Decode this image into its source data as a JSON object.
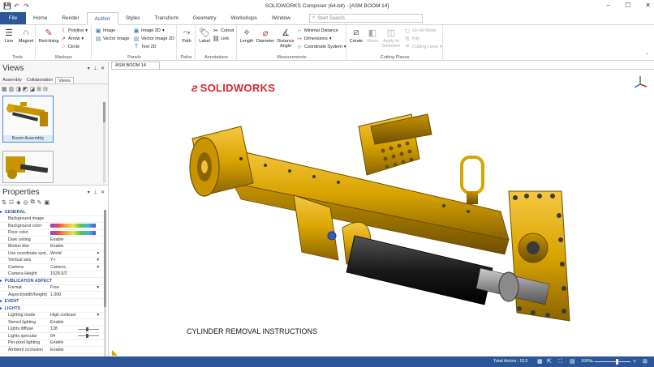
{
  "app": {
    "title": "SOLIDWORKS Composer (64-bit) - [ASM BOOM 14]",
    "window_controls": [
      "–",
      "☐",
      "✕"
    ],
    "quick_access": [
      "save",
      "undo",
      "redo"
    ]
  },
  "tabs": {
    "file": "File",
    "items": [
      "Home",
      "Render",
      "Author",
      "Styles",
      "Transform",
      "Geometry",
      "Workshops",
      "Window"
    ],
    "active": "Author",
    "search_placeholder": "Start Search"
  },
  "ribbon": {
    "groups": {
      "tools": "Tools",
      "markups": "Markups",
      "panels": "Panels",
      "paths": "Paths",
      "annotations": "Annotations",
      "measurements": "Measurements",
      "cutting_planes": "Cutting Planes"
    },
    "tools": {
      "line": "Line",
      "magnet": "Magnet"
    },
    "markups": {
      "redlining": "Red-lining",
      "polyline": "Polyline",
      "arrow": "Arrow",
      "circle": "Circle"
    },
    "panels": {
      "image": "Image",
      "vector_image": "Vector Image",
      "image_2d": "Image 2D",
      "vector_image_2d": "Vector Image 2D",
      "text_2d": "Text 2D"
    },
    "paths": {
      "path": "Path"
    },
    "annotations": {
      "label": "Label",
      "cutout": "Cutout",
      "link": "Link"
    },
    "measurements": {
      "length": "Length",
      "diameter": "Diameter",
      "distance_angle": "Distance Angle",
      "minimal_distance": "Minimal Distance",
      "dimensions": "Dimensions",
      "coordinate_system": "Coordinate System"
    },
    "cutting": {
      "create": "Create",
      "show": "Show",
      "apply_to_selection": "Apply to Selection",
      "on_all_mode": "On All Mode",
      "flip": "Flip",
      "cutting_lines": "Cutting Lines"
    }
  },
  "views_panel": {
    "title": "Views",
    "tabs": [
      "Assembly",
      "Collaboration",
      "Views"
    ],
    "active_tab": "Views",
    "thumbnails": [
      {
        "caption": "Boom Assembly",
        "selected": true
      },
      {
        "caption": "",
        "selected": false
      }
    ]
  },
  "properties_panel": {
    "title": "Properties",
    "rows": [
      {
        "type": "section",
        "label": "GENERAL"
      },
      {
        "label": "Background image",
        "value": ""
      },
      {
        "label": "Background color",
        "value": "",
        "swatch": true
      },
      {
        "label": "Floor color",
        "value": "",
        "swatch": true
      },
      {
        "label": "Dark ceiling",
        "value": "Enable"
      },
      {
        "label": "Motion blur",
        "value": "Enable"
      },
      {
        "label": "Use coordinate syst...",
        "value": "World",
        "dropdown": true
      },
      {
        "label": "Vertical axis",
        "value": "Y+",
        "dropdown": true
      },
      {
        "label": "Camera",
        "value": "Camera",
        "dropdown": true
      },
      {
        "label": "Camera Height",
        "value": "1528.0/2"
      },
      {
        "type": "section",
        "label": "PUBLICATION ASPECT"
      },
      {
        "label": "Format",
        "value": "Free",
        "dropdown": true
      },
      {
        "label": "Aspect(width/height)",
        "value": "1.000"
      },
      {
        "type": "section",
        "label": "EVENT"
      },
      {
        "type": "section",
        "label": "LIGHTS"
      },
      {
        "label": "Lighting mode",
        "value": "High contrast",
        "dropdown": true
      },
      {
        "label": "Stencil lighting",
        "value": "Enable"
      },
      {
        "label": "Lights diffuse",
        "value": "128",
        "slider": true
      },
      {
        "label": "Lights specular",
        "value": "64",
        "slider": true
      },
      {
        "label": "Per-pixel lighting",
        "value": "Enable"
      },
      {
        "label": "Ambient occlusion",
        "value": "Enable"
      }
    ]
  },
  "document": {
    "tab": "ASM BOOM 14",
    "logo_text": "SOLIDWORKS",
    "caption": "CYLINDER REMOVAL INSTRUCTIONS"
  },
  "statusbar": {
    "total_actors": "Total Actors : 513",
    "zoom": "100%"
  },
  "colors": {
    "accent": "#2b579a",
    "model_gold": "#d9a400",
    "logo_red": "#d4262e"
  }
}
